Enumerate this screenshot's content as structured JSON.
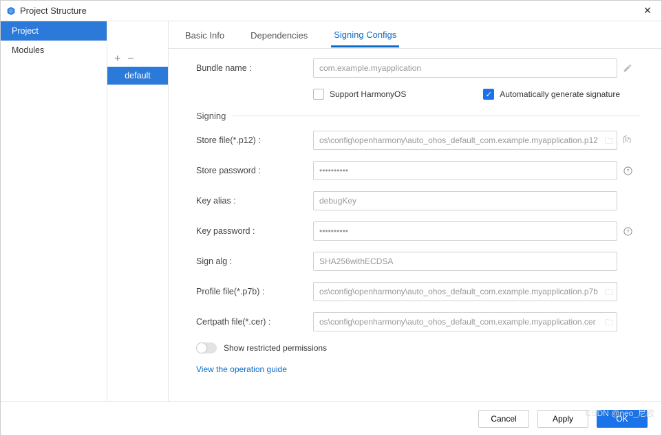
{
  "window": {
    "title": "Project Structure"
  },
  "leftnav": {
    "items": [
      {
        "label": "Project",
        "selected": true
      },
      {
        "label": "Modules",
        "selected": false
      }
    ]
  },
  "midnav": {
    "add_icon": "+",
    "remove_icon": "−",
    "items": [
      {
        "label": "default",
        "selected": true
      }
    ]
  },
  "tabs": [
    {
      "label": "Basic Info",
      "active": false
    },
    {
      "label": "Dependencies",
      "active": false
    },
    {
      "label": "Signing Configs",
      "active": true
    }
  ],
  "form": {
    "bundle_label": "Bundle name :",
    "bundle_value": "com.example.myapplication",
    "support_harmony_label": "Support HarmonyOS",
    "auto_sign_label": "Automatically generate signature",
    "auto_sign_checked": true,
    "section_title": "Signing",
    "store_file_label": "Store file(*.p12) :",
    "store_file_value": "os\\config\\openharmony\\auto_ohos_default_com.example.myapplication.p12",
    "store_password_label": "Store password :",
    "store_password_value": "••••••••••",
    "key_alias_label": "Key alias :",
    "key_alias_value": "debugKey",
    "key_password_label": "Key password :",
    "key_password_value": "••••••••••",
    "sign_alg_label": "Sign alg :",
    "sign_alg_value": "SHA256withECDSA",
    "profile_file_label": "Profile file(*.p7b) :",
    "profile_file_value": "os\\config\\openharmony\\auto_ohos_default_com.example.myapplication.p7b",
    "certpath_label": "Certpath file(*.cer) :",
    "certpath_value": "os\\config\\openharmony\\auto_ohos_default_com.example.myapplication.cer",
    "toggle_label": "Show restricted permissions",
    "guide_link": "View the operation guide"
  },
  "footer": {
    "cancel": "Cancel",
    "apply": "Apply",
    "ok": "OK"
  },
  "watermark": "CSDN @neo_尼欧"
}
